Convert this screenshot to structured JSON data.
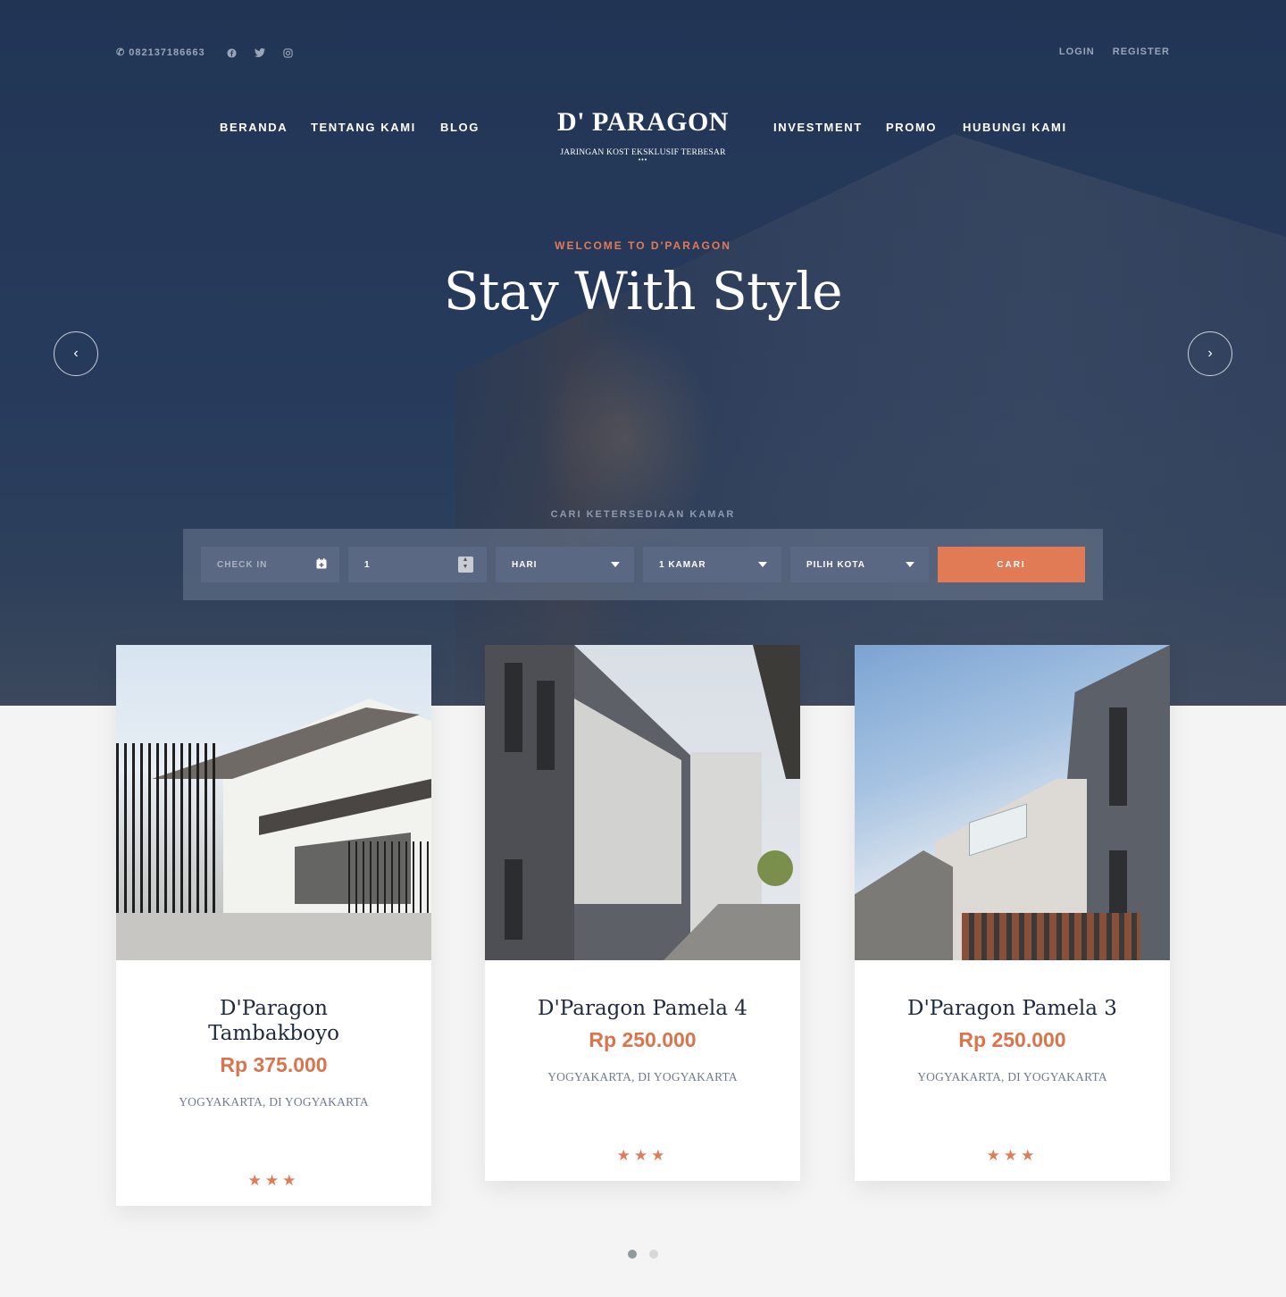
{
  "topbar": {
    "phone": "082137186663",
    "social": [
      "facebook-icon",
      "twitter-icon",
      "instagram-icon"
    ],
    "login": "LOGIN",
    "register": "REGISTER"
  },
  "nav": {
    "left": [
      "BERANDA",
      "TENTANG KAMI",
      "BLOG"
    ],
    "right": [
      "INVESTMENT",
      "PROMO",
      "HUBUNGI KAMI"
    ]
  },
  "logo": {
    "name": "D' PARAGON",
    "tagline": "JARINGAN KOST EKSKLUSIF TERBESAR",
    "dots": "•••"
  },
  "hero": {
    "welcome": "WELCOME TO D'PARAGON",
    "title": "Stay With Style",
    "prev": "‹",
    "next": "›"
  },
  "search": {
    "label": "CARI KETERSEDIAAN KAMAR",
    "checkin_placeholder": "CHECK IN",
    "duration_value": "1",
    "unit_value": "HARI",
    "rooms_value": "1 KAMAR",
    "city_value": "PILIH KOTA",
    "submit": "CARI"
  },
  "listings": [
    {
      "name": "D'Paragon Tambakboyo",
      "price": "Rp 375.000",
      "location": "YOGYAKARTA, DI YOGYAKARTA",
      "rating": 3,
      "stars": "★★★"
    },
    {
      "name": "D'Paragon Pamela 4",
      "price": "Rp 250.000",
      "location": "YOGYAKARTA, DI YOGYAKARTA",
      "rating": 3,
      "stars": "★★★"
    },
    {
      "name": "D'Paragon Pamela 3",
      "price": "Rp 250.000",
      "location": "YOGYAKARTA, DI YOGYAKARTA",
      "rating": 3,
      "stars": "★★★"
    }
  ],
  "carousel": {
    "pages": 2,
    "active": 1
  },
  "colors": {
    "accent": "#e07b56",
    "navy": "#243754",
    "text_dark": "#1f2a3c"
  }
}
